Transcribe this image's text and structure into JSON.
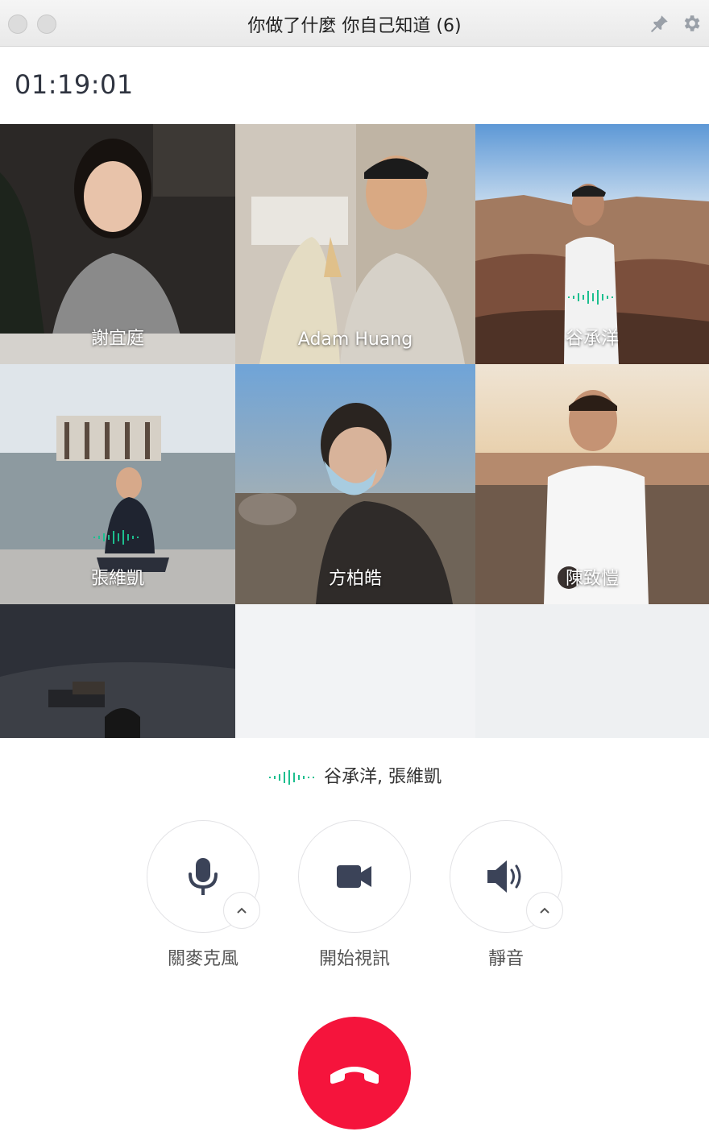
{
  "window": {
    "title": "你做了什麼 你自己知道 (6)"
  },
  "call": {
    "timer": "01:19:01"
  },
  "participants": [
    {
      "name": "謝宜庭",
      "speaking": false
    },
    {
      "name": "Adam Huang",
      "speaking": false
    },
    {
      "name": "谷承洋",
      "speaking": true
    },
    {
      "name": "張維凱",
      "speaking": true
    },
    {
      "name": "方柏皓",
      "speaking": false
    },
    {
      "name": "陳致愷",
      "speaking": false
    },
    {
      "name": "",
      "speaking": false
    }
  ],
  "speaking_now": "谷承洋, 張維凱",
  "controls": {
    "mic_label": "關麥克風",
    "video_label": "開始視訊",
    "speaker_label": "靜音"
  },
  "colors": {
    "accent_green": "#1dbf8f",
    "hangup_red": "#f5143c",
    "icon_dark": "#3b4358"
  },
  "icons": [
    "pin-icon",
    "gear-icon",
    "microphone-icon",
    "video-camera-icon",
    "speaker-icon",
    "chevron-up-icon",
    "hang-up-icon",
    "audio-wave-icon"
  ]
}
